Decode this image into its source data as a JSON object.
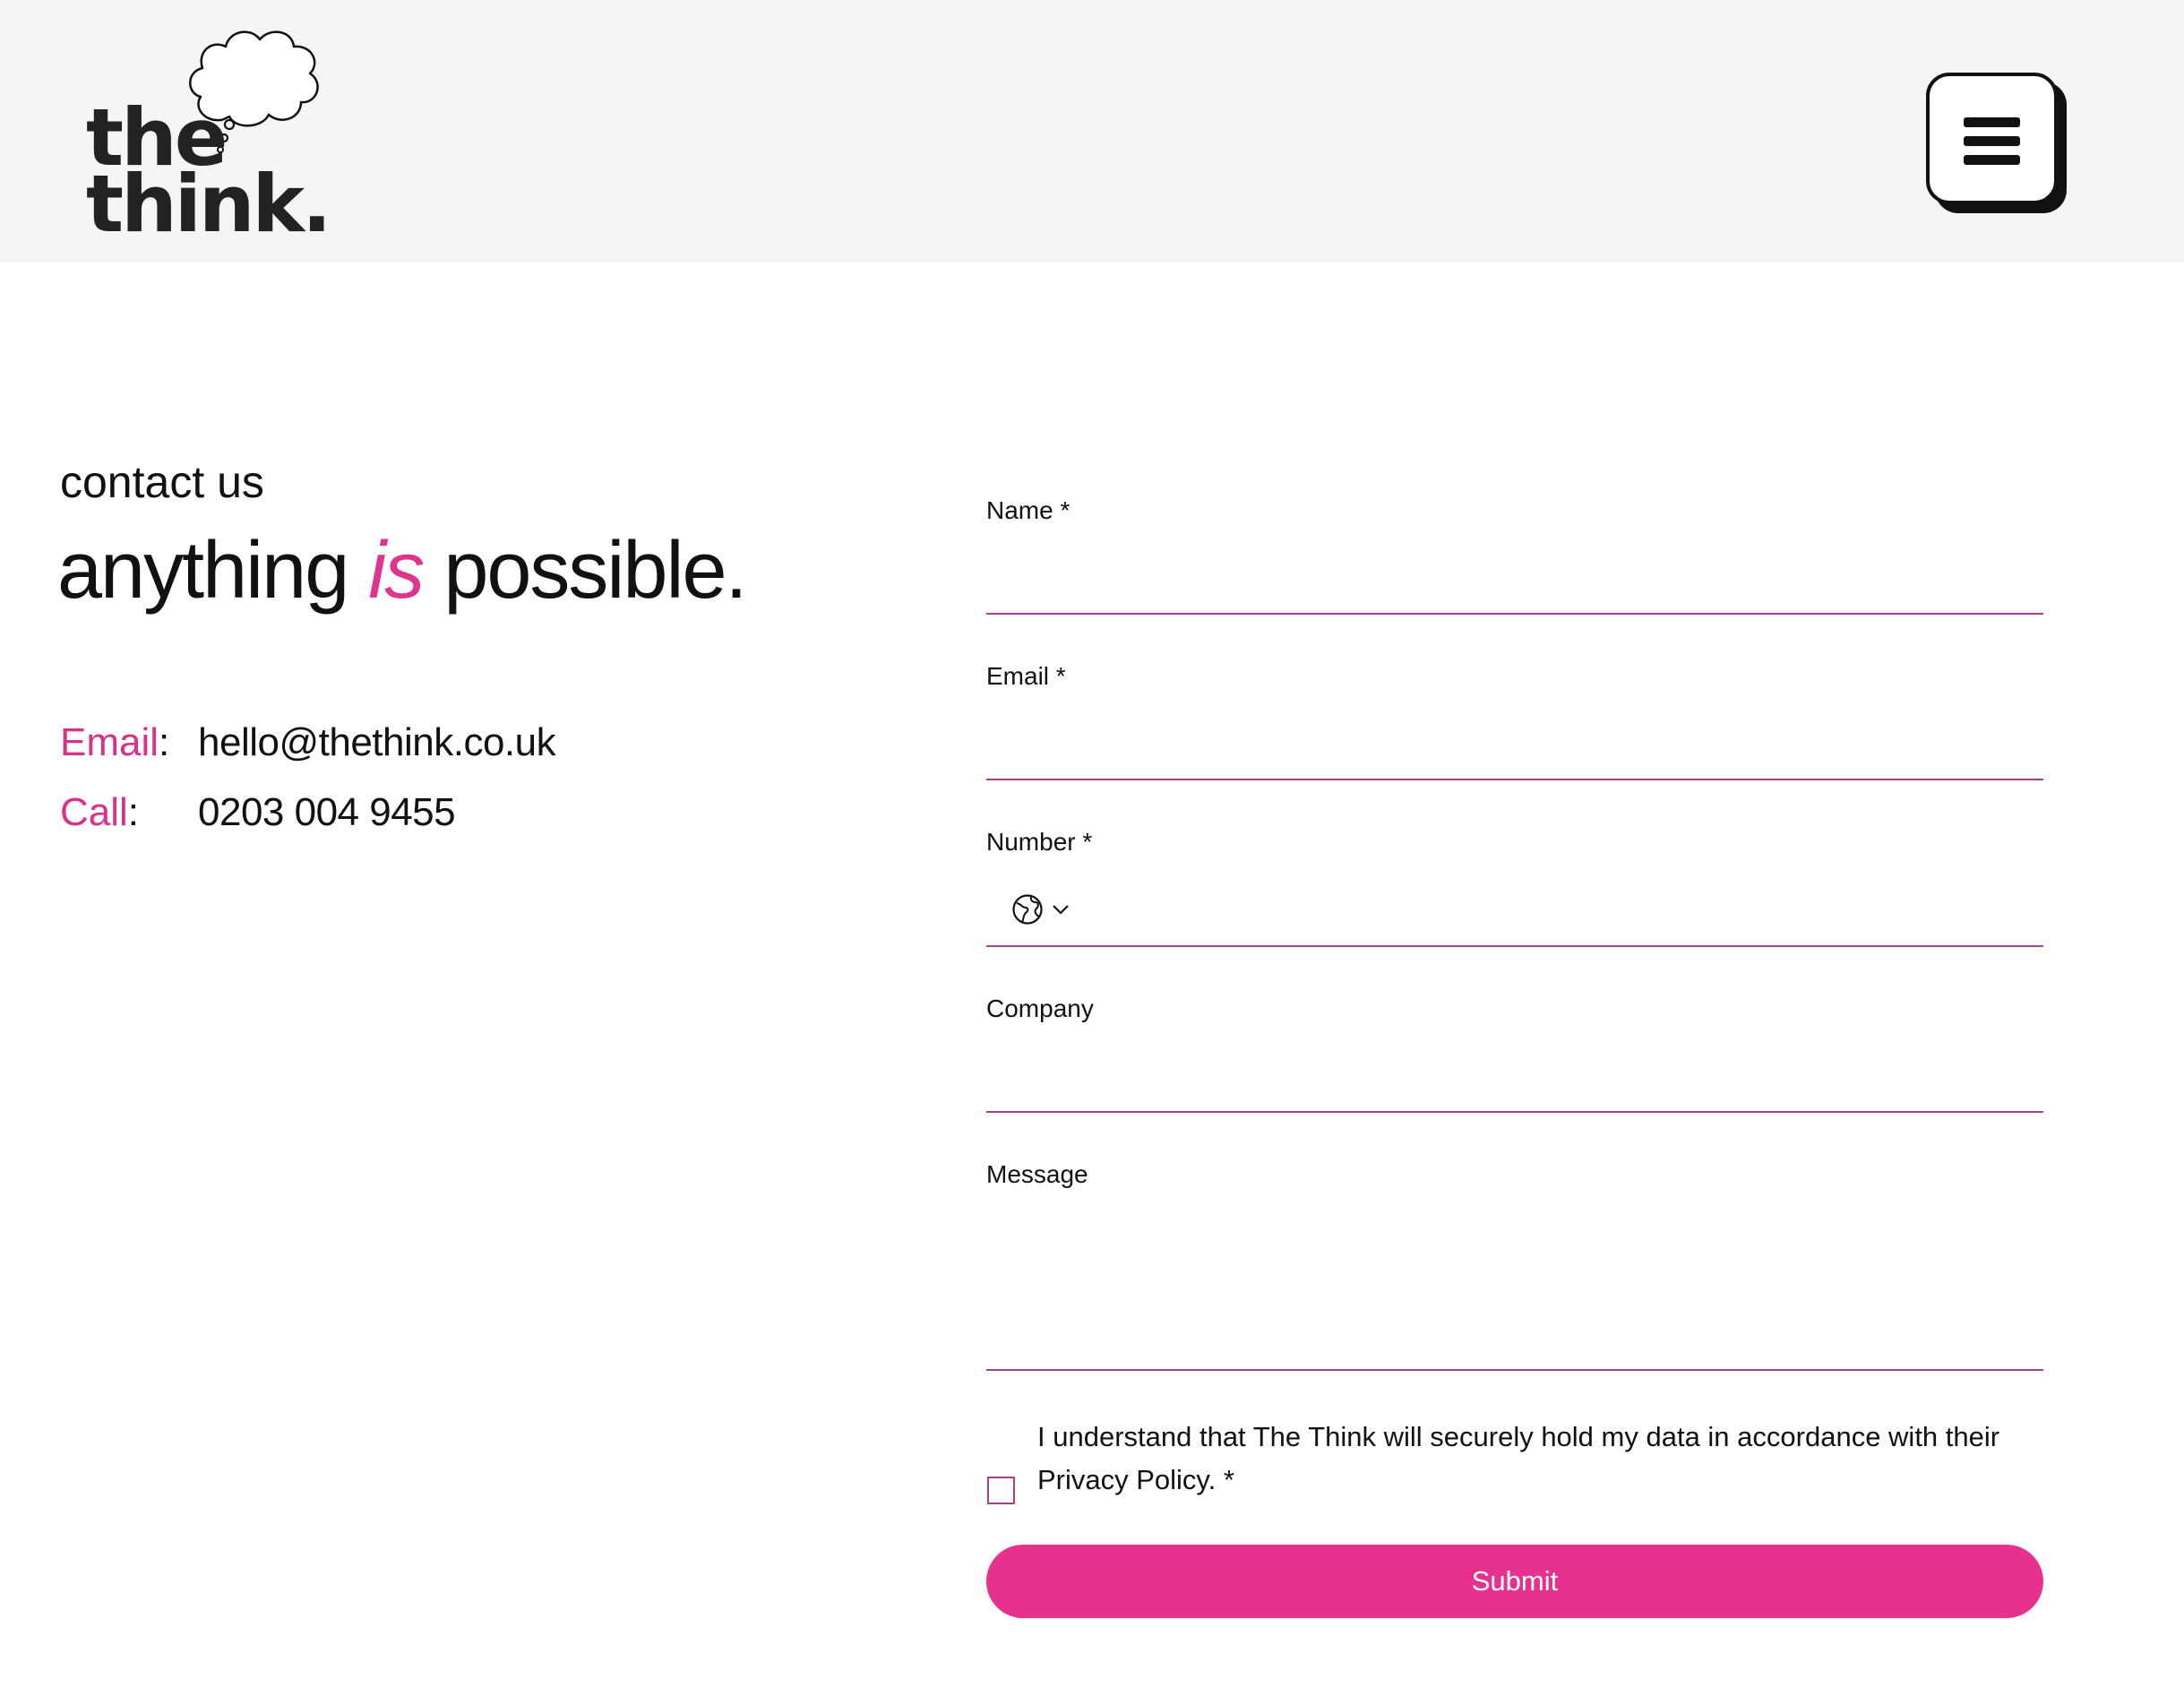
{
  "header": {
    "logo": {
      "line1": "the",
      "line2": "think.",
      "icon": "thought-cloud-icon"
    },
    "menu_icon": "hamburger-menu-icon"
  },
  "intro": {
    "eyebrow": "contact us",
    "headline_start": "anything",
    "headline_accent": "is",
    "headline_end": "possible."
  },
  "contact": {
    "email_label": "Email",
    "email_value": "hello@thethink.co.uk",
    "call_label": "Call",
    "call_value": "0203 004 9455",
    "separator": ":"
  },
  "form": {
    "name_label": "Name *",
    "name_value": "",
    "email_label": "Email *",
    "email_value": "",
    "number_label": "Number *",
    "number_value": "",
    "number_prefix_icon": "globe-icon",
    "number_dropdown_icon": "chevron-down-icon",
    "company_label": "Company",
    "company_value": "",
    "message_label": "Message",
    "message_value": "",
    "consent_text": "I understand that The Think will securely hold my data in accordance with their Privacy Policy. *",
    "consent_checked": false,
    "submit_label": "Submit"
  },
  "colors": {
    "accent": "#e6318f",
    "field_line": "#a9408d",
    "header_bg": "#f5f5f5",
    "text": "#111111"
  }
}
